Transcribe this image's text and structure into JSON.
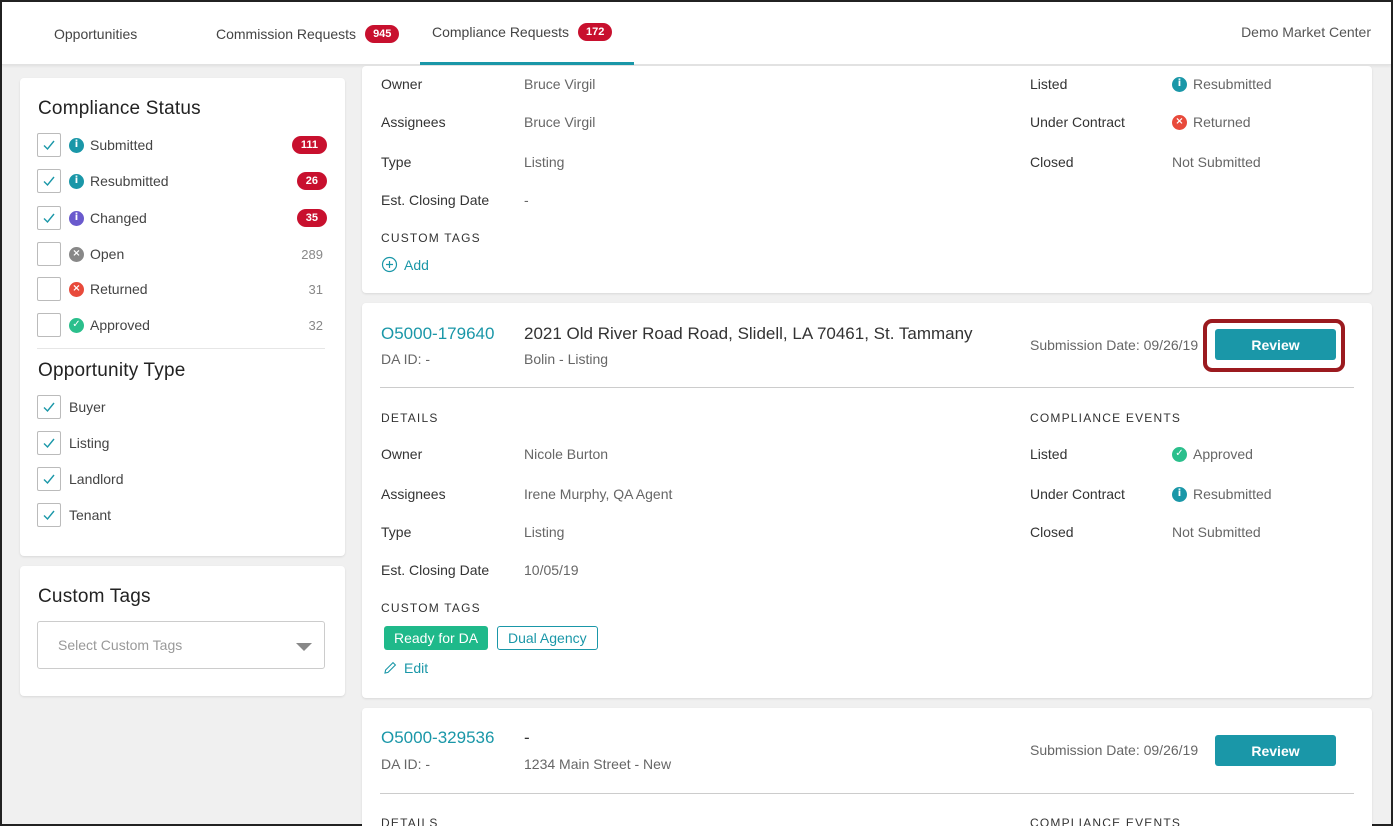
{
  "nav": {
    "tabs": [
      {
        "label": "Opportunities",
        "count": null
      },
      {
        "label": "Commission Requests",
        "count": "945"
      },
      {
        "label": "Compliance Requests",
        "count": "172"
      }
    ],
    "market_center": "Demo Market Center"
  },
  "sidebar": {
    "compliance_status": {
      "title": "Compliance Status",
      "items": [
        {
          "label": "Submitted",
          "count": "111",
          "checked": true,
          "icon": "info-icon",
          "color": "#1a97a8"
        },
        {
          "label": "Resubmitted",
          "count": "26",
          "checked": true,
          "icon": "info-icon",
          "color": "#1a97a8"
        },
        {
          "label": "Changed",
          "count": "35",
          "checked": true,
          "icon": "info-icon",
          "color": "#6a5acd"
        },
        {
          "label": "Open",
          "count": "289",
          "checked": false,
          "icon": "x-circle-icon",
          "color": "#888888"
        },
        {
          "label": "Returned",
          "count": "31",
          "checked": false,
          "icon": "x-circle-icon",
          "color": "#e84a3b"
        },
        {
          "label": "Approved",
          "count": "32",
          "checked": false,
          "icon": "check-circle-icon",
          "color": "#2bbf8c"
        }
      ]
    },
    "opportunity_type": {
      "title": "Opportunity Type",
      "items": [
        {
          "label": "Buyer",
          "checked": true
        },
        {
          "label": "Listing",
          "checked": true
        },
        {
          "label": "Landlord",
          "checked": true
        },
        {
          "label": "Tenant",
          "checked": true
        }
      ]
    },
    "custom_tags": {
      "title": "Custom Tags",
      "placeholder": "Select Custom Tags"
    }
  },
  "cards": [
    {
      "details": {
        "owner_label": "Owner",
        "owner": "Bruce Virgil",
        "assignees_label": "Assignees",
        "assignees": "Bruce Virgil",
        "type_label": "Type",
        "type": "Listing",
        "closing_label": "Est. Closing Date",
        "closing": "-"
      },
      "events": [
        {
          "label": "Listed",
          "status": "Resubmitted",
          "icon": "info-icon"
        },
        {
          "label": "Under Contract",
          "status": "Returned",
          "icon": "x-circle-icon"
        },
        {
          "label": "Closed",
          "status": "Not Submitted",
          "icon": null
        }
      ],
      "custom_tags_label": "CUSTOM TAGS",
      "add_label": "Add"
    },
    {
      "id": "O5000-179640",
      "address": "2021 Old River Road Road, Slidell, LA 70461, St. Tammany",
      "da_id": "DA ID: -",
      "subtitle": "Bolin - Listing",
      "submission": "Submission Date: 09/26/19",
      "review_label": "Review",
      "details_label": "DETAILS",
      "events_label": "COMPLIANCE EVENTS",
      "details": {
        "owner_label": "Owner",
        "owner": "Nicole Burton",
        "assignees_label": "Assignees",
        "assignees": "Irene Murphy, QA Agent",
        "type_label": "Type",
        "type": "Listing",
        "closing_label": "Est. Closing Date",
        "closing": "10/05/19"
      },
      "events": [
        {
          "label": "Listed",
          "status": "Approved",
          "icon": "check-circle-icon"
        },
        {
          "label": "Under Contract",
          "status": "Resubmitted",
          "icon": "info-icon"
        },
        {
          "label": "Closed",
          "status": "Not Submitted",
          "icon": null
        }
      ],
      "custom_tags_label": "CUSTOM TAGS",
      "tags": [
        "Ready for DA",
        "Dual Agency"
      ],
      "edit_label": "Edit"
    },
    {
      "id": "O5000-329536",
      "address": "-",
      "da_id": "DA ID: -",
      "subtitle": "1234 Main Street - New",
      "submission": "Submission Date: 09/26/19",
      "review_label": "Review",
      "details_label": "DETAILS",
      "events_label": "COMPLIANCE EVENTS"
    }
  ],
  "colors": {
    "accent": "#1a97a8",
    "badge": "#c8102e",
    "approved": "#2bbf8c",
    "returned": "#e84a3b",
    "highlight": "#9b1a1f"
  }
}
